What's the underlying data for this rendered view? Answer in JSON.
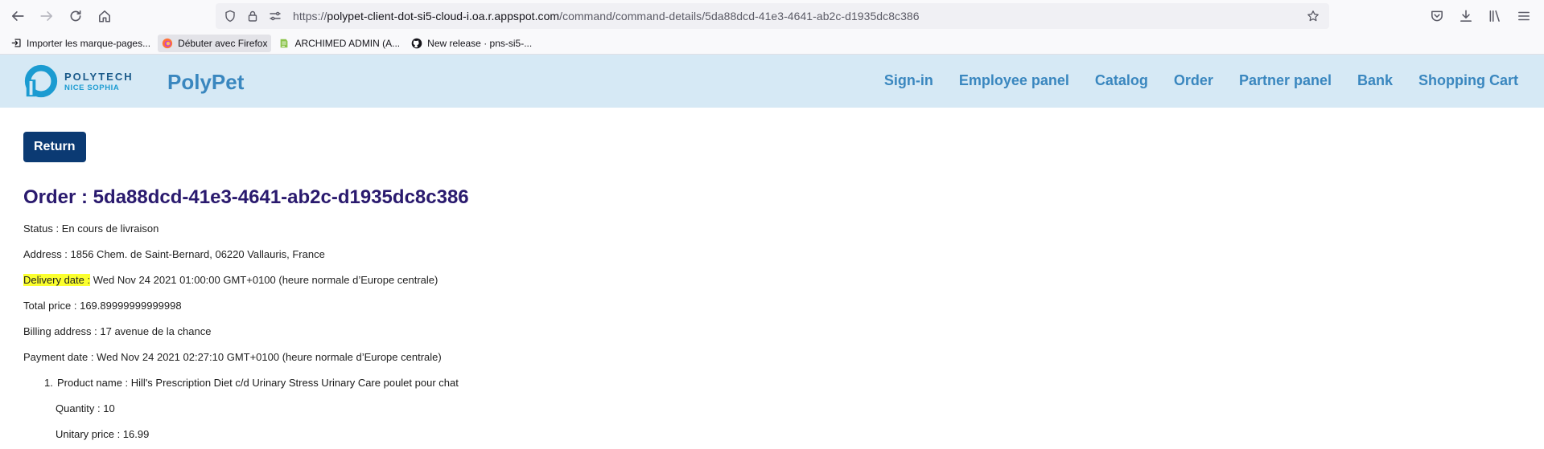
{
  "browser": {
    "url_prefix": "https://",
    "url_host": "polypet-client-dot-si5-cloud-i.oa.r.appspot.com",
    "url_path": "/command/command-details/5da88dcd-41e3-4641-ab2c-d1935dc8c386",
    "bookmarks": [
      {
        "label": "Importer les marque-pages...",
        "icon": "import-icon"
      },
      {
        "label": "Débuter avec Firefox",
        "icon": "firefox-icon"
      },
      {
        "label": "ARCHIMED ADMIN (A...",
        "icon": "archimed-icon"
      },
      {
        "label": "New release · pns-si5-...",
        "icon": "github-icon"
      }
    ]
  },
  "site": {
    "logo_line1": "POLYTECH",
    "logo_line2": "NICE SOPHIA",
    "brand": "PolyPet",
    "nav": [
      "Sign-in",
      "Employee panel",
      "Catalog",
      "Order",
      "Partner panel",
      "Bank",
      "Shopping Cart"
    ],
    "colors": {
      "header_bg": "#d6e9f5",
      "nav": "#3a87bf",
      "button": "#0b3a73",
      "title": "#2a1a6e",
      "highlight": "#fbff2e"
    }
  },
  "order": {
    "return_label": "Return",
    "title": "Order : 5da88dcd-41e3-4641-ab2c-d1935dc8c386",
    "status": "Status : En cours de livraison",
    "address": "Address : 1856 Chem. de Saint-Bernard, 06220 Vallauris, France",
    "delivery_label": "Delivery date :",
    "delivery_value": " Wed Nov 24 2021 01:00:00 GMT+0100 (heure normale d’Europe centrale)",
    "total_price": "Total price : 169.89999999999998",
    "billing_address": "Billing address : 17 avenue de la chance",
    "payment_date": "Payment date : Wed Nov 24 2021 02:27:10 GMT+0100 (heure normale d’Europe centrale)",
    "products": [
      {
        "number": "1.",
        "name": "Product name : Hill's Prescription Diet c/d Urinary Stress Urinary Care poulet pour chat",
        "quantity": "Quantity : 10",
        "unitary_price": "Unitary price : 16.99"
      }
    ]
  }
}
